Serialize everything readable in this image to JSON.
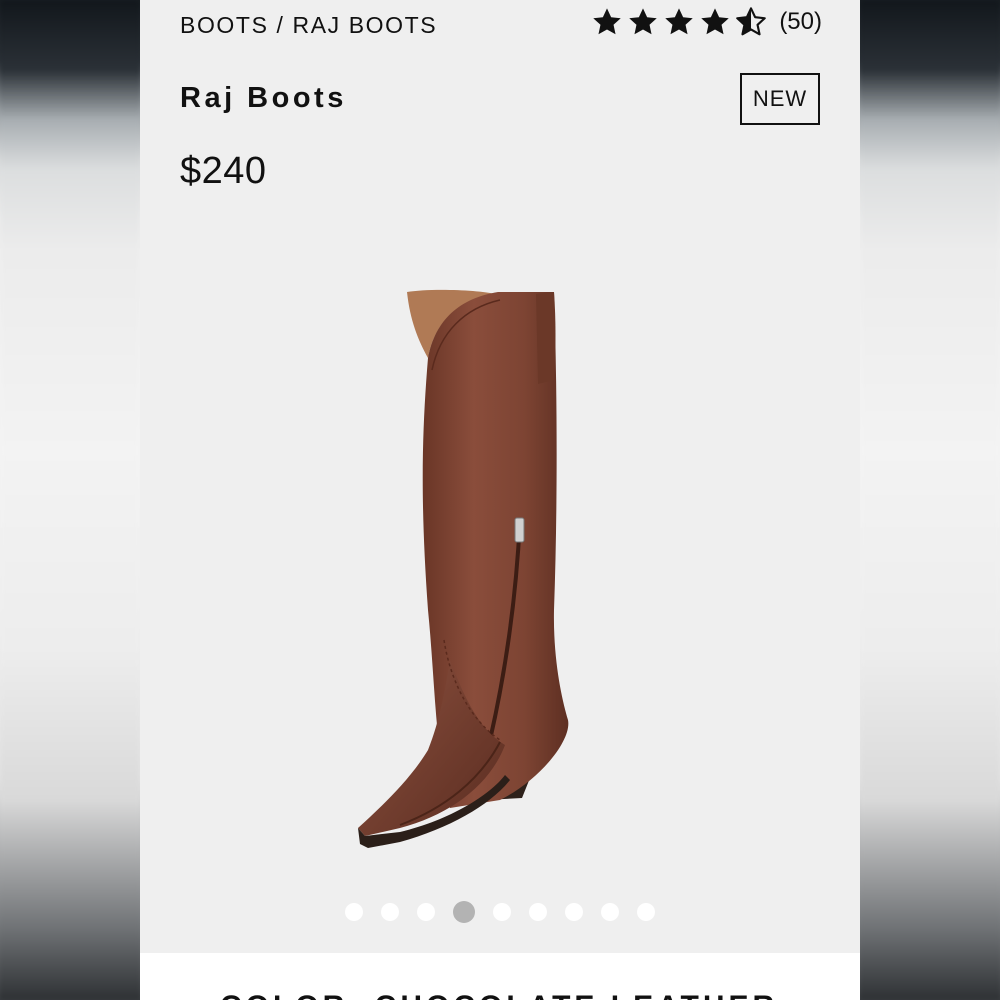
{
  "breadcrumb": "BOOTS / RAJ BOOTS",
  "rating": {
    "value": 4.5,
    "max": 5,
    "count": "(50)"
  },
  "product": {
    "title": "Raj Boots",
    "badge": "NEW",
    "price": "$240",
    "color_label": "COLOR: CHOCOLATE LEATHER"
  },
  "carousel": {
    "total": 9,
    "active_index": 3
  },
  "icons": {
    "star_full": "star-icon",
    "star_half": "star-half-icon"
  },
  "colors": {
    "text": "#111111",
    "panel": "#efefef",
    "dot": "#ffffff",
    "dot_active": "#b3b3b3",
    "boot": "#7a4332"
  }
}
